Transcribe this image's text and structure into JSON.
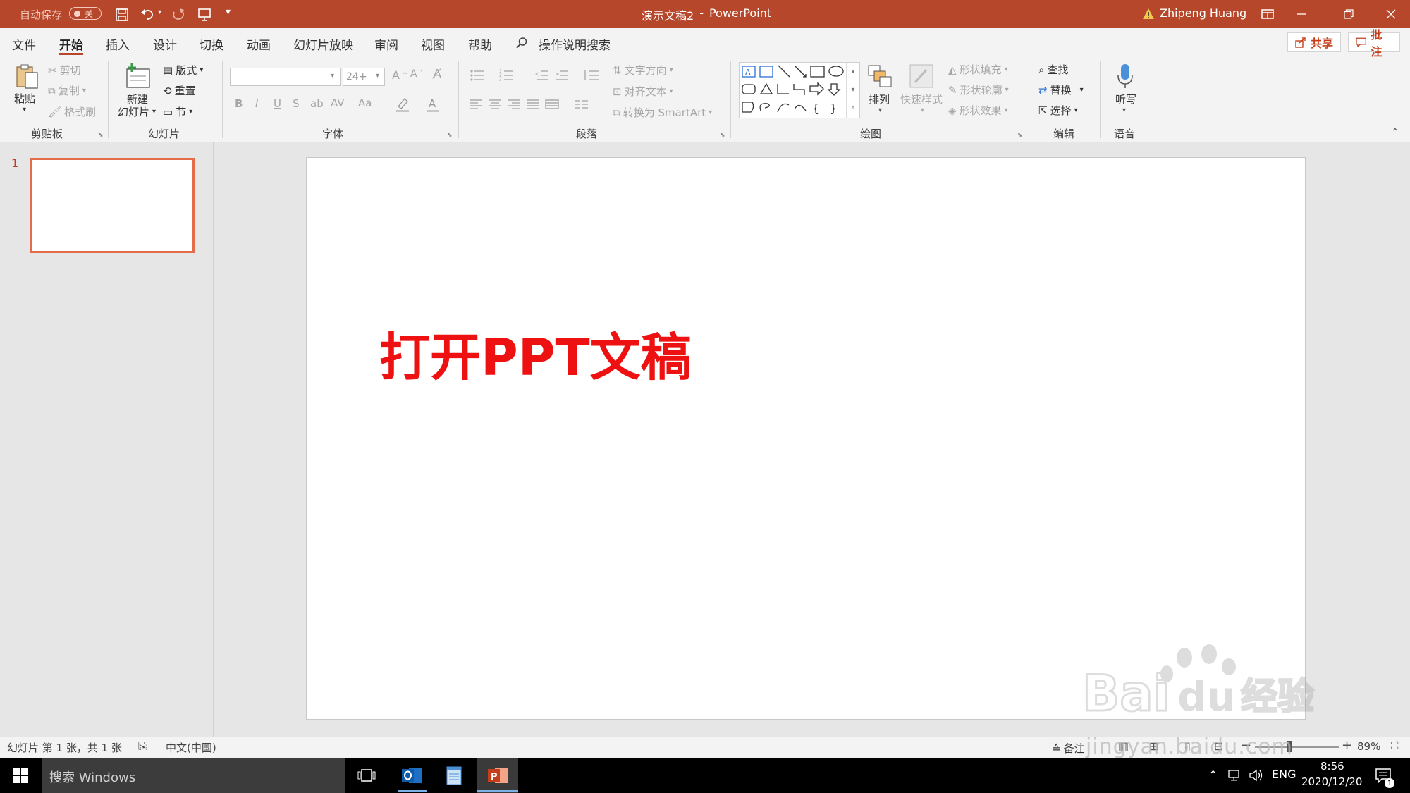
{
  "titlebar": {
    "autosave_label": "自动保存",
    "autosave_state": "关",
    "document_title": "演示文稿2",
    "separator": "-",
    "app_name": "PowerPoint",
    "user_name": "Zhipeng Huang",
    "accent_color": "#b7472a"
  },
  "menu": {
    "tabs": [
      "文件",
      "开始",
      "插入",
      "设计",
      "切换",
      "动画",
      "幻灯片放映",
      "审阅",
      "视图",
      "帮助"
    ],
    "active_tab": "开始",
    "search_label": "操作说明搜索",
    "share_label": "共享",
    "comments_label": "批注"
  },
  "ribbon": {
    "clipboard": {
      "paste": "粘贴",
      "cut": "剪切",
      "copy": "复制",
      "format_painter": "格式刷",
      "label": "剪贴板"
    },
    "slides": {
      "new_slide_line1": "新建",
      "new_slide_line2": "幻灯片",
      "layout": "版式",
      "reset": "重置",
      "section": "节",
      "label": "幻灯片"
    },
    "font": {
      "font_name": "",
      "font_size": "24+",
      "bold": "B",
      "italic": "I",
      "underline": "U",
      "shadow": "S",
      "strike": "ab",
      "spacing": "AV",
      "case": "Aa",
      "label": "字体"
    },
    "paragraph": {
      "text_direction": "文字方向",
      "align_text": "对齐文本",
      "smartart": "转换为 SmartArt",
      "label": "段落"
    },
    "drawing": {
      "arrange": "排列",
      "quick_styles": "快速样式",
      "shape_fill": "形状填充",
      "shape_outline": "形状轮廓",
      "shape_effects": "形状效果",
      "label": "绘图"
    },
    "editing": {
      "find": "查找",
      "replace": "替换",
      "select": "选择",
      "label": "编辑"
    },
    "voice": {
      "dictate": "听写",
      "label": "语音"
    }
  },
  "thumbnails": {
    "slide_number": "1"
  },
  "slide": {
    "title": "打开PPT文稿",
    "title_color": "#ee1111"
  },
  "statusbar": {
    "slide_info": "幻灯片 第 1 张，共 1 张",
    "language": "中文(中国)",
    "notes": "备注",
    "zoom": "89%",
    "watermark": "jingyan.baidu.com"
  },
  "taskbar": {
    "search_placeholder": "搜索 Windows",
    "lang": "ENG",
    "time": "8:56",
    "date": "2020/12/20",
    "notification_count": "1"
  },
  "watermark": {
    "brand": "Bai",
    "brand2": "du",
    "jingyan": "经验"
  }
}
